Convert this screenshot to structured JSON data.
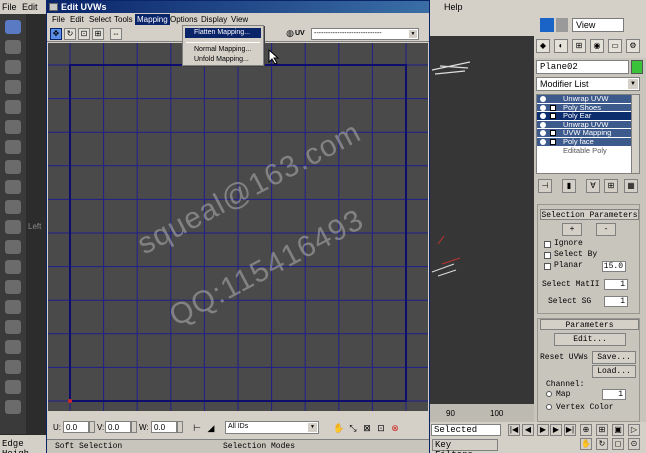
{
  "max_window": {
    "menu": [
      "File",
      "Edit",
      "",
      "Help"
    ],
    "view_dropdown": "View",
    "object_name": "Plane02",
    "modifier_list": "Modifier List",
    "left_label": "Left",
    "edge_height": "Edge Heigh",
    "status_selected": "Selected",
    "key_filters": "Key Filters...",
    "timeline_ticks": [
      "90",
      "100"
    ],
    "colors": {
      "object_color": "#3bc23b",
      "stack_selected": "#0b2d6e"
    }
  },
  "modifier_stack": {
    "items": [
      "Unwrap UVW",
      "Poly Shoes",
      "Poly Ear",
      "Unwrap UVW",
      "UVW Mapping",
      "Poly face",
      "Editable Poly"
    ]
  },
  "selection_params": {
    "title": "Selection Parameters",
    "plus": "+",
    "minus": "-",
    "ignore": "Ignore",
    "select_by": "Select By",
    "planar": "Planar",
    "planar_value": "15.0",
    "select_matid": "Select MatII",
    "select_matid_value": "1",
    "select_sg": "Select SG",
    "select_sg_value": "1"
  },
  "parameters": {
    "title": "Parameters",
    "edit_button": "Edit...",
    "reset_uvws": "Reset UVWs",
    "save_button": "Save...",
    "load_button": "Load...",
    "channel_label": "Channel:",
    "map_label": "Map",
    "map_value": "1",
    "vertex_color": "Vertex Color"
  },
  "uvw_dialog": {
    "title": "Edit UVWs",
    "menu": [
      "File",
      "Edit",
      "Select",
      "Tools",
      "Mapping",
      "Options",
      "Display",
      "View"
    ],
    "active_menu": "Mapping",
    "uv_toggle": "UV",
    "texture_dropdown": "-----------------------------",
    "mapping_menu": [
      "Flatten Mapping...",
      "Normal Mapping...",
      "Unfold Mapping..."
    ],
    "highlighted_item": "Flatten Mapping...",
    "coords": {
      "u_label": "U:",
      "u_value": "0.0",
      "v_label": "V:",
      "v_value": "0.0",
      "w_label": "W:",
      "w_value": "0.0"
    },
    "ids_dropdown": "All IDs",
    "footer_left": "Soft Selection",
    "footer_right": "Selection Modes",
    "colors": {
      "canvas": "#4a4a4a",
      "grid": "#1f1f8c",
      "menu_highlight": "#0a246a"
    }
  },
  "watermark": {
    "line1": "squeal@163.com",
    "line2": "QQ:115416493"
  }
}
